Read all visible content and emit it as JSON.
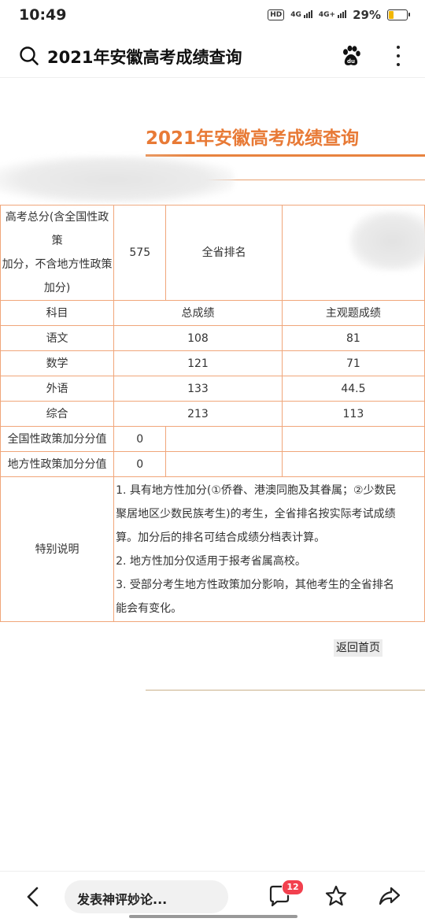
{
  "status_bar": {
    "time": "10:49",
    "hd": "HD",
    "net1": "4G",
    "net2": "4G+",
    "battery_percent": "29%",
    "battery_level": 0.29,
    "battery_color": "#f2b705"
  },
  "title_bar": {
    "title": "2021年安徽高考成绩查询",
    "icons": [
      "search-icon",
      "baidu-paw-icon",
      "more-vertical-icon"
    ]
  },
  "content": {
    "heading": "2021年安徽高考成绩查询",
    "accent_color": "#e87a36",
    "table": {
      "total_label_lines": [
        "高考总分(含全国性政策",
        "加分，不含地方性政策",
        "加分)"
      ],
      "total_score": "575",
      "rank_label": "全省排名",
      "rank_value": "",
      "headers": [
        "科目",
        "总成绩",
        "主观题成绩"
      ],
      "rows": [
        {
          "subject": "语文",
          "total": "108",
          "subjective": "81"
        },
        {
          "subject": "数学",
          "total": "121",
          "subjective": "71"
        },
        {
          "subject": "外语",
          "total": "133",
          "subjective": "44.5"
        },
        {
          "subject": "综合",
          "total": "213",
          "subjective": "113"
        }
      ],
      "national_bonus_label": "全国性政策加分分值",
      "national_bonus_value": "0",
      "local_bonus_label": "地方性政策加分分值",
      "local_bonus_value": "0",
      "note_label": "特别说明",
      "note_lines": [
        "1. 具有地方性加分(①侨眷、港澳同胞及其眷属；②少数民",
        "聚居地区少数民族考生)的考生，全省排名按实际考试成绩",
        "算。加分后的排名可结合成绩分档表计算。",
        "2. 地方性加分仅适用于报考省属高校。",
        "3. 受部分考生地方性政策加分影响，其他考生的全省排名",
        "能会有变化。"
      ]
    },
    "back_home_label": "返回首页"
  },
  "bottom_bar": {
    "comment_placeholder": "发表神评妙论...",
    "comment_count": "12",
    "badge_color": "#f2404e",
    "icons": [
      "back-arrow-icon",
      "comment-icon",
      "star-icon",
      "share-icon"
    ]
  }
}
